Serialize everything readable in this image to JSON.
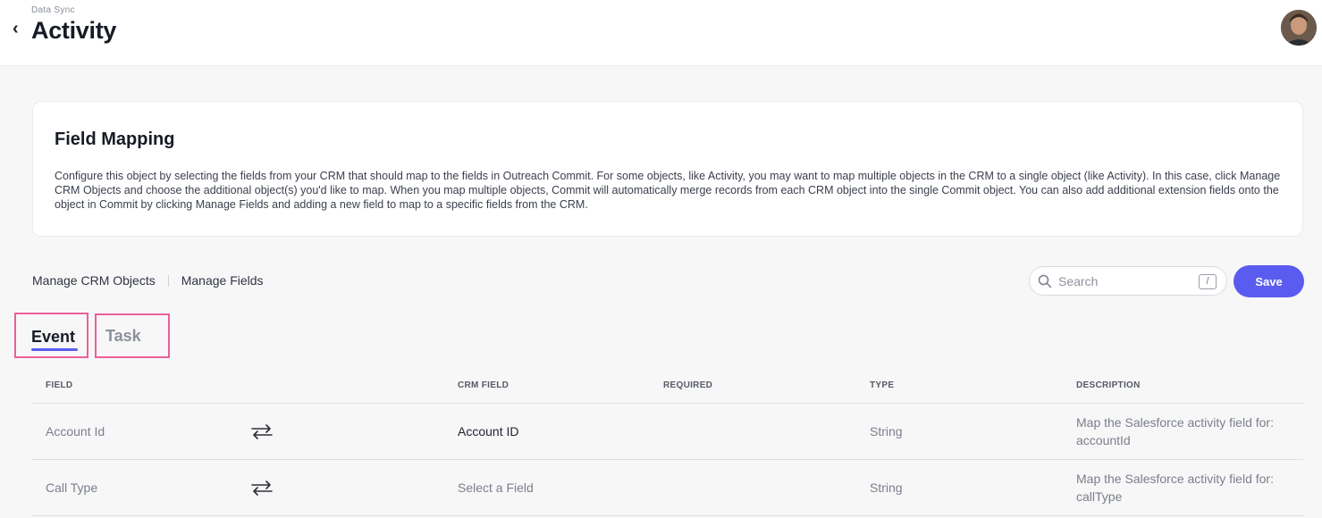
{
  "header": {
    "breadcrumb": "Data Sync",
    "title": "Activity"
  },
  "field_mapping": {
    "title": "Field Mapping",
    "description": "Configure this object by selecting the fields from your CRM that should map to the fields in Outreach Commit. For some objects, like Activity, you may want to map multiple objects in the CRM to a single object (like Activity). In this case, click Manage CRM Objects and choose the additional object(s) you'd like to map. When you map multiple objects, Commit will automatically merge records from each CRM object into the single Commit object. You can also add additional extension fields onto the object in Commit by clicking Manage Fields and adding a new field to map to a specific fields from the CRM."
  },
  "toolbar": {
    "manage_crm_objects": "Manage CRM Objects",
    "manage_fields": "Manage Fields",
    "search_placeholder": "Search",
    "search_shortcut": "/",
    "save_label": "Save"
  },
  "tabs": [
    {
      "label": "Event",
      "active": true
    },
    {
      "label": "Task",
      "active": false
    }
  ],
  "table": {
    "columns": [
      "FIELD",
      "CRM FIELD",
      "REQUIRED",
      "TYPE",
      "DESCRIPTION"
    ],
    "rows": [
      {
        "field": "Account Id",
        "crm_field": "Account ID",
        "crm_field_set": true,
        "required": "",
        "type": "String",
        "description": "Map the Salesforce activity field for: accountId"
      },
      {
        "field": "Call Type",
        "crm_field": "Select a Field",
        "crm_field_set": false,
        "required": "",
        "type": "String",
        "description": "Map the Salesforce activity field for: callType"
      }
    ]
  },
  "colors": {
    "accent": "#5a5cf0",
    "highlight_border": "#ec5f9a"
  },
  "icons": {
    "back": "chevron-left-icon",
    "search": "search-icon",
    "map": "swap-arrows-icon"
  }
}
